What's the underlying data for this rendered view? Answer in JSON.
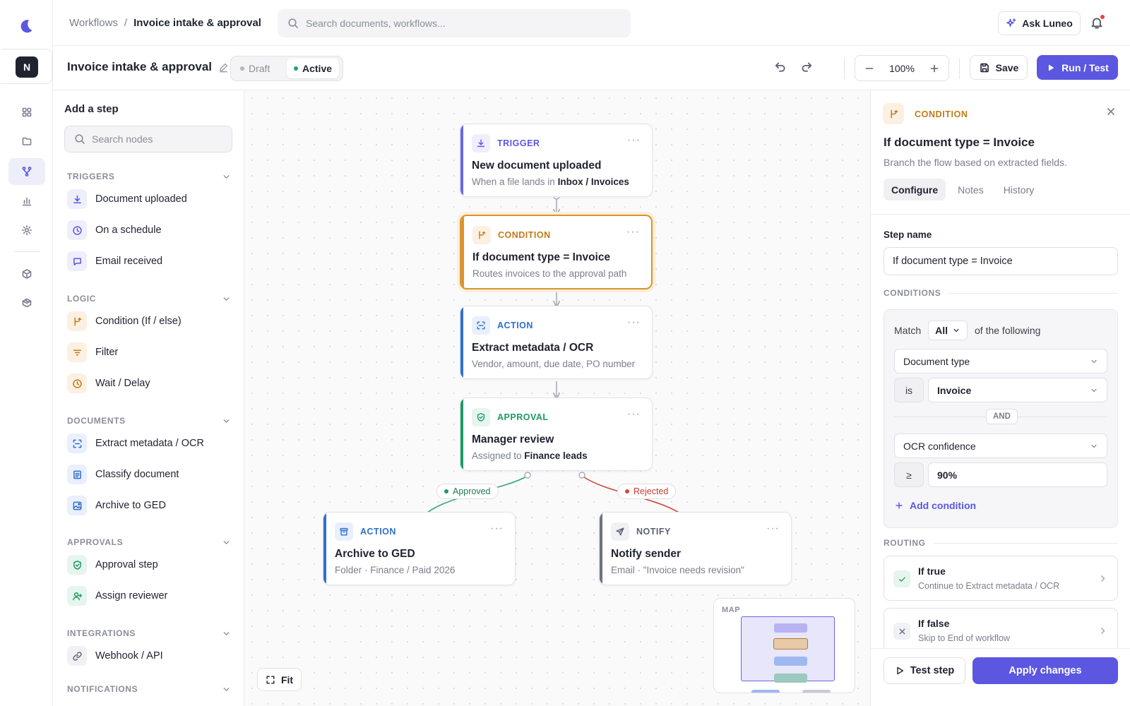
{
  "rail": {
    "workspace_initial": "N",
    "items": [
      {
        "icon": "grid-icon",
        "active": false
      },
      {
        "icon": "folder-icon",
        "active": false
      },
      {
        "icon": "workflow-icon",
        "active": true
      },
      {
        "icon": "chart-icon",
        "active": false
      },
      {
        "icon": "gear-icon",
        "active": false
      },
      {
        "icon": "cube-icon",
        "active": false
      },
      {
        "icon": "box-icon",
        "active": false
      }
    ]
  },
  "header": {
    "breadcrumb_root": "Workflows",
    "breadcrumb_sep": "/",
    "breadcrumb_current": "Invoice intake & approval",
    "search_placeholder": "Search documents, workflows...",
    "ask_label": "Ask Luneo"
  },
  "workflow_bar": {
    "title": "Invoice intake & approval",
    "status_options": [
      "Draft",
      "Active"
    ],
    "status_selected": "Active",
    "zoom": "100%",
    "save_label": "Save",
    "run_label": "Run / Test"
  },
  "palette": {
    "title": "Add a step",
    "search_placeholder": "Search nodes",
    "sections": [
      {
        "label": "TRIGGERS",
        "items": [
          {
            "label": "Document uploaded",
            "icon": "download-icon",
            "color": "purple"
          },
          {
            "label": "On a schedule",
            "icon": "clock-icon",
            "color": "purple"
          },
          {
            "label": "Email received",
            "icon": "message-icon",
            "color": "purple"
          }
        ]
      },
      {
        "label": "LOGIC",
        "items": [
          {
            "label": "Condition (If / else)",
            "icon": "branch-icon",
            "color": "orange"
          },
          {
            "label": "Filter",
            "icon": "filter-icon",
            "color": "orange"
          },
          {
            "label": "Wait / Delay",
            "icon": "clock-icon",
            "color": "orange"
          }
        ]
      },
      {
        "label": "DOCUMENTS",
        "items": [
          {
            "label": "Extract metadata / OCR",
            "icon": "scan-icon",
            "color": "blue"
          },
          {
            "label": "Classify document",
            "icon": "document-icon",
            "color": "blue"
          },
          {
            "label": "Archive to GED",
            "icon": "image-icon",
            "color": "blue"
          }
        ]
      },
      {
        "label": "APPROVALS",
        "items": [
          {
            "label": "Approval step",
            "icon": "shield-check-icon",
            "color": "green"
          },
          {
            "label": "Assign reviewer",
            "icon": "user-plus-icon",
            "color": "green"
          }
        ]
      },
      {
        "label": "INTEGRATIONS",
        "items": [
          {
            "label": "Webhook / API",
            "icon": "link-icon",
            "color": "gray"
          }
        ]
      },
      {
        "label": "NOTIFICATIONS",
        "items": []
      }
    ]
  },
  "canvas": {
    "nodes": [
      {
        "id": "trigger",
        "type": "TRIGGER",
        "name": "New document uploaded",
        "sub_pre": "When a file lands in ",
        "sub_bold": "Inbox / Invoices",
        "sub_post": "",
        "icon": "download-icon",
        "accent": "#6b67e6",
        "type_color": "#5b57e0",
        "icon_bg": "#efeefc",
        "selected": false
      },
      {
        "id": "condition",
        "type": "CONDITION",
        "name": "If document type = Invoice",
        "sub_pre": "Routes invoices to the approval path",
        "sub_bold": "",
        "sub_post": "",
        "icon": "branch-icon",
        "accent": "#d9952c",
        "type_color": "#c27a17",
        "icon_bg": "#fcf0e2",
        "selected": true
      },
      {
        "id": "ocr",
        "type": "ACTION",
        "name": "Extract metadata / OCR",
        "sub_pre": "Vendor, amount, due date, PO number",
        "sub_bold": "",
        "sub_post": "",
        "icon": "scan-icon",
        "accent": "#2f6fd0",
        "type_color": "#2f6fd0",
        "icon_bg": "#e9f0fc",
        "selected": false
      },
      {
        "id": "approval",
        "type": "APPROVAL",
        "name": "Manager review",
        "sub_pre": "Assigned to ",
        "sub_bold": "Finance leads",
        "sub_post": "",
        "icon": "shield-check-icon",
        "accent": "#1f9a62",
        "type_color": "#1f9a62",
        "icon_bg": "#e6f5ee",
        "selected": false
      },
      {
        "id": "archive",
        "type": "ACTION",
        "name": "Archive to GED",
        "sub_pre": "Folder · Finance / Paid 2026",
        "sub_bold": "",
        "sub_post": "",
        "icon": "archive-icon",
        "accent": "#2f6fd0",
        "type_color": "#2f6fd0",
        "icon_bg": "#e9f0fc",
        "selected": false
      },
      {
        "id": "notify",
        "type": "NOTIFY",
        "name": "Notify sender",
        "sub_pre": "Email · \"Invoice needs revision\"",
        "sub_bold": "",
        "sub_post": "",
        "icon": "send-icon",
        "accent": "#6e7280",
        "type_color": "#5c6070",
        "icon_bg": "#f0f1f4",
        "selected": false
      }
    ],
    "edge_labels": {
      "approved": "Approved",
      "rejected": "Rejected",
      "approved_color": "#1f9a62",
      "rejected_color": "#d2483c"
    },
    "fit_label": "Fit",
    "minimap_label": "MAP"
  },
  "inspector": {
    "type": "CONDITION",
    "title": "If document type = Invoice",
    "description": "Branch the flow based on extracted fields.",
    "tabs": [
      "Configure",
      "Notes",
      "History"
    ],
    "active_tab": "Configure",
    "step_name_label": "Step name",
    "step_name_value": "If document type = Invoice",
    "conditions_label": "CONDITIONS",
    "match_prefix": "Match",
    "match_value": "All",
    "match_suffix": "of the following",
    "conditions": [
      {
        "field": "Document type",
        "operator": "is",
        "value": "Invoice"
      },
      {
        "field": "OCR confidence",
        "operator": "≥",
        "value": "90%"
      }
    ],
    "joiner": "AND",
    "add_condition": "Add condition",
    "routing_label": "ROUTING",
    "routes": [
      {
        "title": "If true",
        "sub": "Continue to Extract metadata / OCR",
        "kind": "true"
      },
      {
        "title": "If false",
        "sub": "Skip to End of workflow",
        "kind": "false"
      }
    ],
    "test_label": "Test step",
    "apply_label": "Apply changes"
  }
}
